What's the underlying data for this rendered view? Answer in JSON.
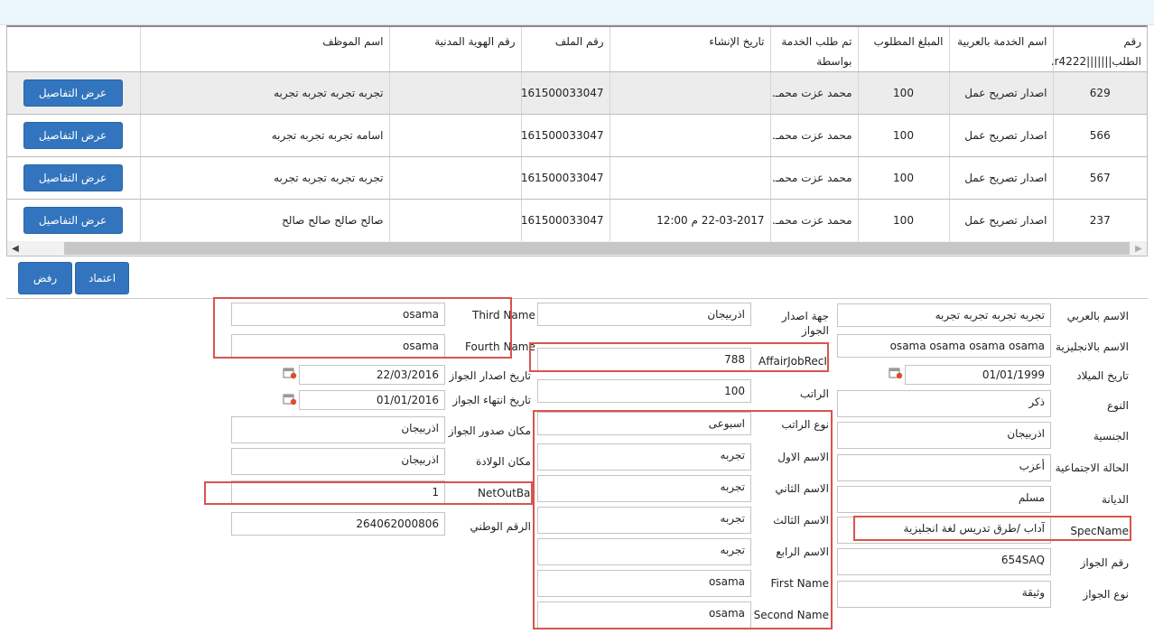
{
  "table": {
    "headers": [
      "رقم الطلب|||||||r4222.",
      "اسم الخدمة بالعربية",
      "المبلغ المطلوب",
      "تم طلب الخدمة بواسطة",
      "تاريخ الإنشاء",
      "رقم الملف",
      "رقم الهوية المدنية",
      "اسم الموظف",
      ""
    ],
    "rows": [
      {
        "id": "629",
        "service": "اصدار تصريح عمل",
        "amount": "100",
        "by": "محمد عزت محمـ...",
        "created": "",
        "file": "161500033047",
        "civil": "",
        "employee": "تجربه تجربه تجربه تجربه",
        "action": "عرض التفاصيل"
      },
      {
        "id": "566",
        "service": "اصدار تصريح عمل",
        "amount": "100",
        "by": "محمد عزت محمـ...",
        "created": "",
        "file": "161500033047",
        "civil": "",
        "employee": "اسامه تجربه تجربه تجربه",
        "action": "عرض التفاصيل"
      },
      {
        "id": "567",
        "service": "اصدار تصريح عمل",
        "amount": "100",
        "by": "محمد عزت محمـ...",
        "created": "",
        "file": "161500033047",
        "civil": "",
        "employee": "تجربه تجربه تجربه تجربه",
        "action": "عرض التفاصيل"
      },
      {
        "id": "237",
        "service": "اصدار تصريح عمل",
        "amount": "100",
        "by": "محمد عزت محمـ...",
        "created": "22-03-2017 م 12:00",
        "file": "161500033047",
        "civil": "",
        "employee": "صالح صالح صالح صالح",
        "action": "عرض التفاصيل"
      }
    ]
  },
  "actions": {
    "approve": "اعتماد",
    "reject": "رفض"
  },
  "form": {
    "col1": {
      "name_ar": {
        "label": "الاسم بالعربي",
        "value": "تجربه تجربه تجربه تجربه"
      },
      "name_en": {
        "label": "الاسم بالانجليزية",
        "value": "osama osama osama osama"
      },
      "birth_date": {
        "label": "تاريخ الميلاد",
        "value": "01/01/1999"
      },
      "gender": {
        "label": "النوع",
        "value": "ذكر"
      },
      "nationality": {
        "label": "الجنسية",
        "value": "اذربيجان"
      },
      "marital": {
        "label": "الحالة الاجتماعية",
        "value": "أعزب"
      },
      "religion": {
        "label": "الديانة",
        "value": "مسلم"
      },
      "spec": {
        "label": "SpecName",
        "value": "آداب /طرق تدريس لغة انجليزية"
      },
      "passport_no": {
        "label": "رقم الجواز",
        "value": "654SAQ"
      },
      "passport_type": {
        "label": "نوع الجواز",
        "value": "وثيقة"
      }
    },
    "col2": {
      "issuer": {
        "label": "جهة اصدار الجواز",
        "value": "اذربيجان"
      },
      "affair": {
        "label": "AffairJobRecId",
        "value": "788"
      },
      "salary": {
        "label": "الراتب",
        "value": "100"
      },
      "salary_type": {
        "label": "نوع الراتب",
        "value": "اسبوعى"
      },
      "first_ar": {
        "label": "الاسم الاول",
        "value": "تجربه"
      },
      "second_ar": {
        "label": "الاسم الثاني",
        "value": "تجربه"
      },
      "third_ar": {
        "label": "الاسم الثالث",
        "value": "تجربه"
      },
      "fourth_ar": {
        "label": "الاسم الرابع",
        "value": "تجربه"
      },
      "first_en": {
        "label": "First Name",
        "value": "osama"
      },
      "second_en": {
        "label": "Second Name",
        "value": "osama"
      }
    },
    "col3": {
      "third_en": {
        "label": "Third Name",
        "value": "osama"
      },
      "fourth_en": {
        "label": "Fourth Name",
        "value": "osama"
      },
      "pass_issue": {
        "label": "تاريخ اصدار الجواز",
        "value": "22/03/2016"
      },
      "pass_expiry": {
        "label": "تاريخ انتهاء الجواز",
        "value": "01/01/2016"
      },
      "pass_place": {
        "label": "مكان صدور الجواز",
        "value": "اذربيجان"
      },
      "birth_place": {
        "label": "مكان الولادة",
        "value": "اذربيجان"
      },
      "net_out": {
        "label": "NetOutBal",
        "value": "1"
      },
      "national_no": {
        "label": "الرقم الوطني",
        "value": "264062000806"
      }
    }
  },
  "colors": {
    "accent": "#3275be",
    "highlight": "#d9534f"
  }
}
